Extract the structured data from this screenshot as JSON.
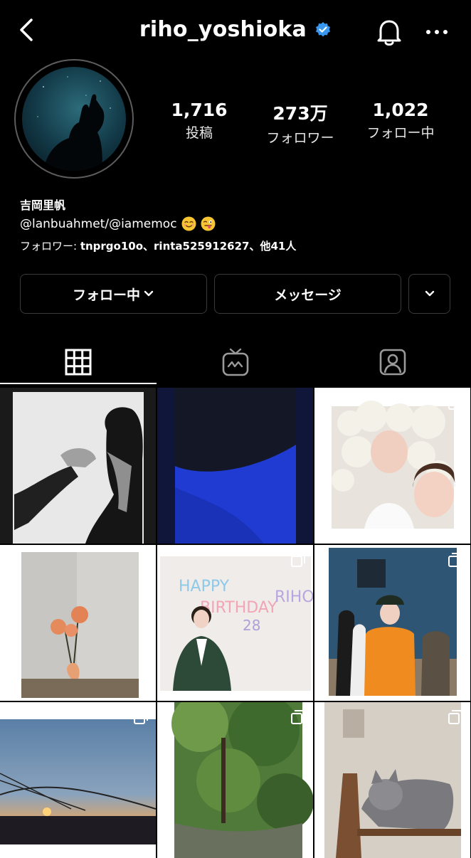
{
  "header": {
    "username": "riho_yoshioka",
    "verified": true
  },
  "stats": [
    {
      "value": "1,716",
      "label": "投稿"
    },
    {
      "value": "273万",
      "label": "フォロワー"
    },
    {
      "value": "1,022",
      "label": "フォロー中"
    }
  ],
  "profile": {
    "display_name": "吉岡里帆",
    "bio": "@lanbuahmet/@iamemoc",
    "followed_by_prefix": "フォロワー: ",
    "followed_by_names": "tnprgo10o、rinta525912627、他41人"
  },
  "buttons": {
    "following": "フォロー中",
    "message": "メッセージ"
  },
  "tabs": [
    "grid-icon",
    "igtv-icon",
    "tagged-icon"
  ],
  "colors": {
    "verified": "#3897f0",
    "background": "#000000"
  }
}
